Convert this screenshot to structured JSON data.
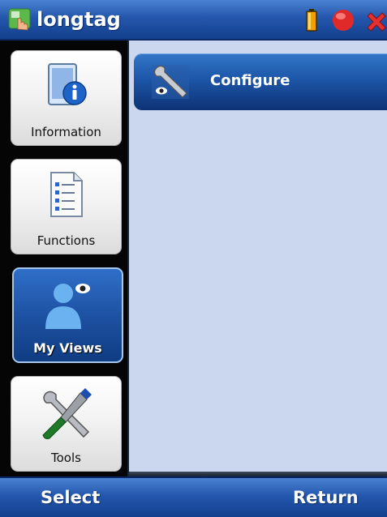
{
  "titlebar": {
    "title": "longtag",
    "icons": [
      "app-icon",
      "battery-icon",
      "record-icon",
      "close-icon"
    ]
  },
  "sidebar": {
    "items": [
      {
        "label": "Information",
        "icon": "info-icon"
      },
      {
        "label": "Functions",
        "icon": "list-icon"
      },
      {
        "label": "My Views",
        "icon": "user-view-icon",
        "selected": true
      },
      {
        "label": "Tools",
        "icon": "tools-icon"
      }
    ]
  },
  "main": {
    "items": [
      {
        "label": "Configure",
        "icon": "configure-icon"
      }
    ]
  },
  "softkeys": {
    "left": "Select",
    "right": "Return"
  },
  "colors": {
    "bar_blue": "#2457ad",
    "content_bg": "#cbd7ef",
    "battery": "#f0a000",
    "record": "#e02a2a"
  }
}
